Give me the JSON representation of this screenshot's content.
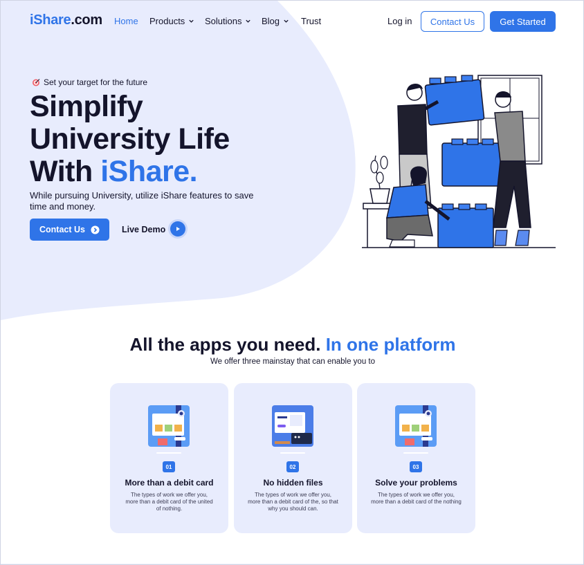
{
  "brand": {
    "name_part1": "iShare",
    "name_part2": ".com",
    "accent_color": "#2f74e8",
    "bg_shape_color": "#e8ecfd"
  },
  "nav": {
    "items": [
      {
        "label": "Home",
        "active": true,
        "dropdown": false
      },
      {
        "label": "Products",
        "active": false,
        "dropdown": true
      },
      {
        "label": "Solutions",
        "active": false,
        "dropdown": true
      },
      {
        "label": "Blog",
        "active": false,
        "dropdown": true
      },
      {
        "label": "Trust",
        "active": false,
        "dropdown": false
      }
    ],
    "login_label": "Log in",
    "contact_label": "Contact Us",
    "cta_label": "Get Started"
  },
  "hero": {
    "tagline": "Set your target for the future",
    "title_line1": "Simplify",
    "title_line2": "University Life",
    "title_line3_prefix": "With ",
    "title_line3_accent": "iShare.",
    "subtitle": "While pursuing University, utilize iShare features to save time and money.",
    "contact_button": "Contact Us",
    "demo_label": "Live Demo"
  },
  "features": {
    "title_prefix": "All the apps you need. ",
    "title_accent": "In one platform",
    "subtitle": "We offer three mainstay that can enable you to",
    "cards": [
      {
        "number": "01",
        "title": "More than a debit card",
        "description": "The types of work we offer you, more than a debit card of the united of nothing."
      },
      {
        "number": "02",
        "title": "No hidden files",
        "description": "The types of work we offer you, more than a debit card of the, so that why you should can."
      },
      {
        "number": "03",
        "title": "Solve your problems",
        "description": "The types of work we offer you, more than a debit card of the nothing"
      }
    ]
  }
}
